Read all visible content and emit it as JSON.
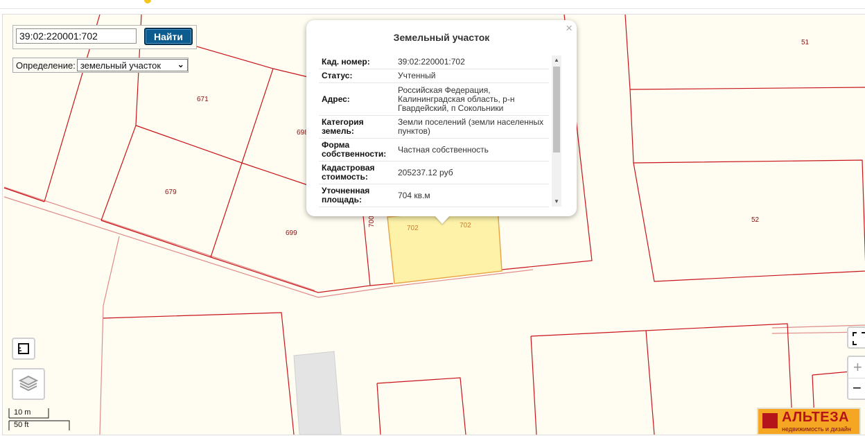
{
  "search": {
    "value": "39:02:220001:702",
    "button_label": "Найти"
  },
  "definition": {
    "label": "Определение:",
    "selected": "земельный участок"
  },
  "popup": {
    "title": "Земельный участок",
    "close_symbol": "×",
    "rows": [
      {
        "key": "Кад. номер:",
        "value": "39:02:220001:702"
      },
      {
        "key": "Статус:",
        "value": "Учтенный"
      },
      {
        "key": "Адрес:",
        "value": "Российская Федерация, Калининградская область, р-н Гвардейский, п Сокольники"
      },
      {
        "key": "Категория земель:",
        "value": "Земли поселений (земли населенных пунктов)"
      },
      {
        "key": "Форма собственности:",
        "value": "Частная собственность"
      },
      {
        "key": "Кадастровая стоимость:",
        "value": "205237.12 руб"
      },
      {
        "key": "Уточненная площадь:",
        "value": "704 кв.м"
      }
    ]
  },
  "parcels": {
    "p671": "671",
    "p698": "698",
    "p679": "679",
    "p699": "699",
    "p700": "700",
    "p702a": "702",
    "p702b": "702",
    "p51": "51",
    "p52": "52"
  },
  "scale": {
    "metric": "10 m",
    "imperial": "50 ft"
  },
  "logo": {
    "name": "АЛЬТЕЗА",
    "tagline": "недвижимость и дизайн"
  },
  "colors": {
    "parcel_line": "#c8141a",
    "road_line": "#e08a8a",
    "selected_fill": "#fdf2a8",
    "selected_stroke": "#e8a84a",
    "map_bg": "#fffdf1",
    "button_bg": "#0c5c8f"
  },
  "icons": {
    "ruler": "ruler-icon",
    "layers": "layers-icon",
    "fullscreen": "fullscreen-icon",
    "zoom_in": "+",
    "zoom_out": "−"
  }
}
